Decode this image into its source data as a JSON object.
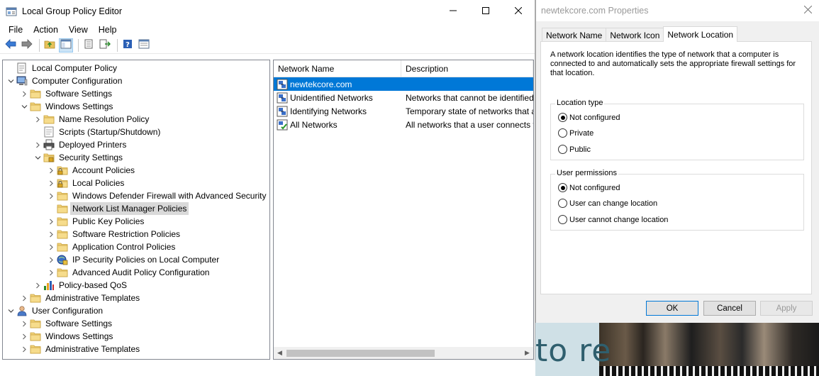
{
  "window": {
    "title": "Local Group Policy Editor",
    "minimize_icon": "minimize-icon",
    "maximize_icon": "maximize-icon",
    "close_icon": "close-icon"
  },
  "menu": [
    "File",
    "Action",
    "View",
    "Help"
  ],
  "toolbar": [
    "back-arrow-icon",
    "forward-arrow-icon",
    "up-folder-icon",
    "show-hide-tree-icon",
    "properties-icon",
    "export-list-icon",
    "help-icon",
    "extended-view-icon"
  ],
  "tree": [
    {
      "label": "Local Computer Policy",
      "depth": 0,
      "chevron": "",
      "icon": "policy-icon"
    },
    {
      "label": "Computer Configuration",
      "depth": 0,
      "chevron": "expanded",
      "icon": "computer-icon"
    },
    {
      "label": "Software Settings",
      "depth": 1,
      "chevron": "collapsed",
      "icon": "folder-icon"
    },
    {
      "label": "Windows Settings",
      "depth": 1,
      "chevron": "expanded",
      "icon": "folder-icon"
    },
    {
      "label": "Name Resolution Policy",
      "depth": 2,
      "chevron": "collapsed",
      "icon": "folder-icon"
    },
    {
      "label": "Scripts (Startup/Shutdown)",
      "depth": 2,
      "chevron": "",
      "icon": "script-icon"
    },
    {
      "label": "Deployed Printers",
      "depth": 2,
      "chevron": "collapsed",
      "icon": "printer-icon"
    },
    {
      "label": "Security Settings",
      "depth": 2,
      "chevron": "expanded",
      "icon": "security-folder-icon"
    },
    {
      "label": "Account Policies",
      "depth": 3,
      "chevron": "collapsed",
      "icon": "lock-folder-icon"
    },
    {
      "label": "Local Policies",
      "depth": 3,
      "chevron": "collapsed",
      "icon": "lock-folder-icon"
    },
    {
      "label": "Windows Defender Firewall with Advanced Security",
      "depth": 3,
      "chevron": "collapsed",
      "icon": "folder-icon"
    },
    {
      "label": "Network List Manager Policies",
      "depth": 3,
      "chevron": "",
      "icon": "folder-icon",
      "selected": true
    },
    {
      "label": "Public Key Policies",
      "depth": 3,
      "chevron": "collapsed",
      "icon": "folder-icon"
    },
    {
      "label": "Software Restriction Policies",
      "depth": 3,
      "chevron": "collapsed",
      "icon": "folder-icon"
    },
    {
      "label": "Application Control Policies",
      "depth": 3,
      "chevron": "collapsed",
      "icon": "folder-icon"
    },
    {
      "label": "IP Security Policies on Local Computer",
      "depth": 3,
      "chevron": "collapsed",
      "icon": "ipsec-icon"
    },
    {
      "label": "Advanced Audit Policy Configuration",
      "depth": 3,
      "chevron": "collapsed",
      "icon": "folder-icon"
    },
    {
      "label": "Policy-based QoS",
      "depth": 2,
      "chevron": "collapsed",
      "icon": "chart-icon"
    },
    {
      "label": "Administrative Templates",
      "depth": 1,
      "chevron": "collapsed",
      "icon": "folder-icon"
    },
    {
      "label": "User Configuration",
      "depth": 0,
      "chevron": "expanded",
      "icon": "user-icon"
    },
    {
      "label": "Software Settings",
      "depth": 1,
      "chevron": "collapsed",
      "icon": "folder-icon"
    },
    {
      "label": "Windows Settings",
      "depth": 1,
      "chevron": "collapsed",
      "icon": "folder-icon"
    },
    {
      "label": "Administrative Templates",
      "depth": 1,
      "chevron": "collapsed",
      "icon": "folder-icon"
    }
  ],
  "list": {
    "columns": [
      "Network Name",
      "Description"
    ],
    "rows": [
      {
        "name": "newtekcore.com",
        "description": "",
        "selected": true
      },
      {
        "name": "Unidentified Networks",
        "description": "Networks that cannot be identified"
      },
      {
        "name": "Identifying Networks",
        "description": "Temporary state of networks that a"
      },
      {
        "name": "All Networks",
        "description": "All networks that a user connects t"
      }
    ],
    "scroll_left_icon": "scroll-left-icon",
    "scroll_right_icon": "scroll-right-icon"
  },
  "properties": {
    "title": "newtekcore.com Properties",
    "tabs": [
      "Network Name",
      "Network Icon",
      "Network Location"
    ],
    "active_tab": "Network Location",
    "description": "A network location identifies the type of network that a computer is connected to and automatically sets the appropriate firewall settings for that location.",
    "location_type": {
      "legend": "Location type",
      "options": [
        "Not configured",
        "Private",
        "Public"
      ],
      "selected": "Not configured"
    },
    "user_permissions": {
      "legend": "User permissions",
      "options": [
        "Not configured",
        "User can change location",
        "User cannot change location"
      ],
      "selected": "Not configured"
    },
    "buttons": {
      "ok": "OK",
      "cancel": "Cancel",
      "apply": "Apply"
    }
  },
  "desktop": {
    "text": "to re"
  },
  "colors": {
    "selection": "#0078d7",
    "folder": "#e8c25a"
  }
}
